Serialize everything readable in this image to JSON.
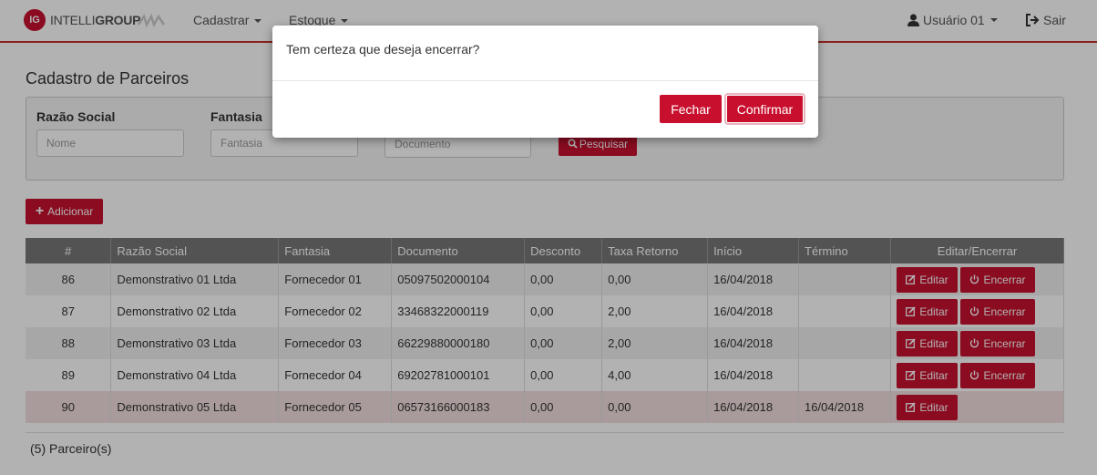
{
  "navbar": {
    "brand_mark": "IG",
    "brand_text_light": "INTELLI",
    "brand_text_bold": "GROUP",
    "menu_cadastrar": "Cadastrar",
    "menu_estoque": "Estoque",
    "user_label": "Usuário 01",
    "logout_label": "Sair"
  },
  "page": {
    "title": "Cadastro de Parceiros"
  },
  "filters": {
    "razao_label": "Razão Social",
    "razao_placeholder": "Nome",
    "fantasia_label": "Fantasia",
    "fantasia_placeholder": "Fantasia",
    "documento_placeholder": "Documento",
    "search_label": "Pesquisar"
  },
  "add_button": "Adicionar",
  "table": {
    "columns": [
      "#",
      "Razão Social",
      "Fantasia",
      "Documento",
      "Desconto",
      "Taxa Retorno",
      "Início",
      "Término",
      "Editar/Encerrar"
    ],
    "rows": [
      {
        "id": "86",
        "razao": "Demonstrativo 01 Ltda",
        "fantasia": "Fornecedor 01",
        "documento": "05097502000104",
        "desconto": "0,00",
        "taxa": "0,00",
        "inicio": "16/04/2018",
        "termino": "",
        "edit": "Editar",
        "close": "Encerrar"
      },
      {
        "id": "87",
        "razao": "Demonstrativo 02 Ltda",
        "fantasia": "Fornecedor 02",
        "documento": "33468322000119",
        "desconto": "0,00",
        "taxa": "2,00",
        "inicio": "16/04/2018",
        "termino": "",
        "edit": "Editar",
        "close": "Encerrar"
      },
      {
        "id": "88",
        "razao": "Demonstrativo 03 Ltda",
        "fantasia": "Fornecedor 03",
        "documento": "66229880000180",
        "desconto": "0,00",
        "taxa": "2,00",
        "inicio": "16/04/2018",
        "termino": "",
        "edit": "Editar",
        "close": "Encerrar"
      },
      {
        "id": "89",
        "razao": "Demonstrativo 04 Ltda",
        "fantasia": "Fornecedor 04",
        "documento": "69202781000101",
        "desconto": "0,00",
        "taxa": "4,00",
        "inicio": "16/04/2018",
        "termino": "",
        "edit": "Editar",
        "close": "Encerrar"
      },
      {
        "id": "90",
        "razao": "Demonstrativo 05 Ltda",
        "fantasia": "Fornecedor 05",
        "documento": "06573166000183",
        "desconto": "0,00",
        "taxa": "0,00",
        "inicio": "16/04/2018",
        "termino": "16/04/2018",
        "edit": "Editar"
      }
    ]
  },
  "count_label": "(5) Parceiro(s)",
  "modal": {
    "message": "Tem certeza que deseja encerrar?",
    "close_label": "Fechar",
    "confirm_label": "Confirmar"
  },
  "colors": {
    "accent": "#c8102e",
    "header_bg": "#777777",
    "inactive_row": "#f2dede"
  },
  "icons": [
    "user-icon",
    "sign-out-icon",
    "search-icon",
    "plus-icon",
    "edit-icon",
    "power-icon"
  ]
}
